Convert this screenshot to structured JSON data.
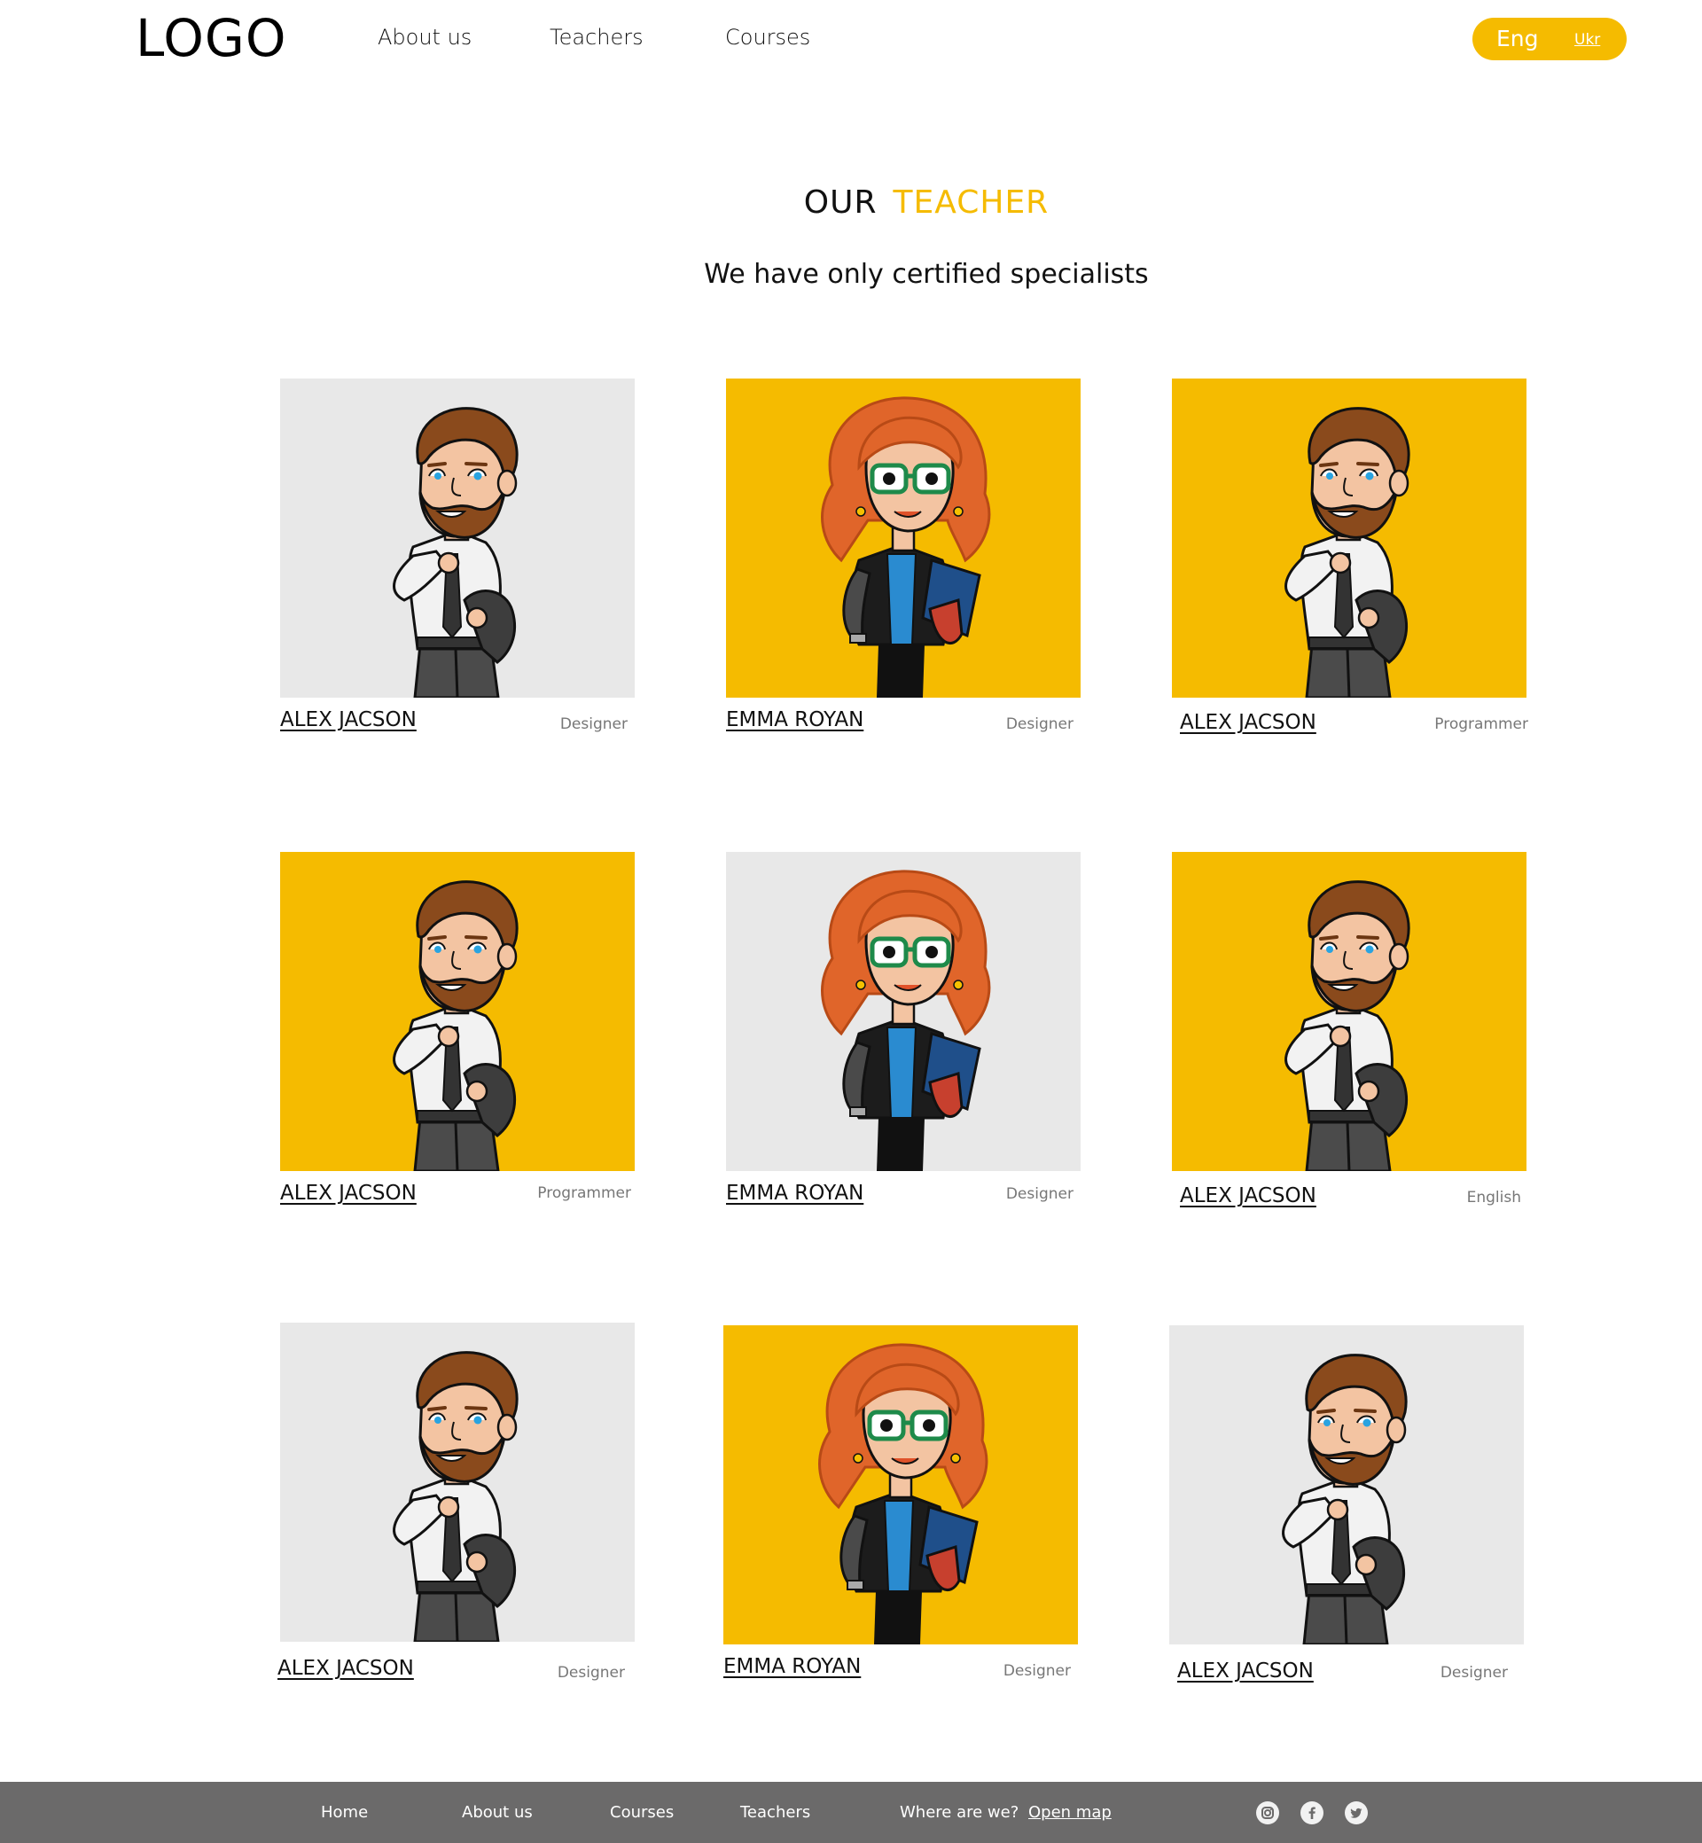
{
  "header": {
    "logo": "LOGO",
    "nav": [
      "About us",
      "Teachers",
      "Courses"
    ],
    "lang_active": "Eng",
    "lang_other": "Ukr"
  },
  "section": {
    "title_word1": "OUR",
    "title_word2": "TEACHER",
    "subtitle": "We have only certified specialists"
  },
  "teachers": [
    {
      "name": "ALEX JACSON",
      "role": "Designer",
      "bg": "#e8e8e8",
      "avatar": "man"
    },
    {
      "name": "EMMA  ROYAN",
      "role": "Designer",
      "bg": "#f5bb00",
      "avatar": "woman"
    },
    {
      "name": "ALEX JACSON",
      "role": "Programmer",
      "bg": "#f5bb00",
      "avatar": "man"
    },
    {
      "name": "ALEX JACSON",
      "role": "Programmer",
      "bg": "#f5bb00",
      "avatar": "man"
    },
    {
      "name": "EMMA  ROYAN",
      "role": "Designer",
      "bg": "#e8e8e8",
      "avatar": "woman"
    },
    {
      "name": "ALEX JACSON",
      "role": "English",
      "bg": "#f5bb00",
      "avatar": "man"
    },
    {
      "name": "ALEX JACSON",
      "role": "Designer",
      "bg": "#e8e8e8",
      "avatar": "man"
    },
    {
      "name": "EMMA  ROYAN",
      "role": "Designer",
      "bg": "#f5bb00",
      "avatar": "woman"
    },
    {
      "name": "ALEX JACSON",
      "role": "Designer",
      "bg": "#e8e8e8",
      "avatar": "man"
    }
  ],
  "footer": {
    "links": [
      "Home",
      "About  us",
      "Courses",
      "Teachers"
    ],
    "where": "Where are we?",
    "map": "Open map",
    "social": [
      "instagram-icon",
      "facebook-icon",
      "twitter-icon"
    ]
  },
  "colors": {
    "accent": "#f5bb00",
    "footer": "#6b6a6a",
    "card_grey": "#e8e8e8"
  }
}
